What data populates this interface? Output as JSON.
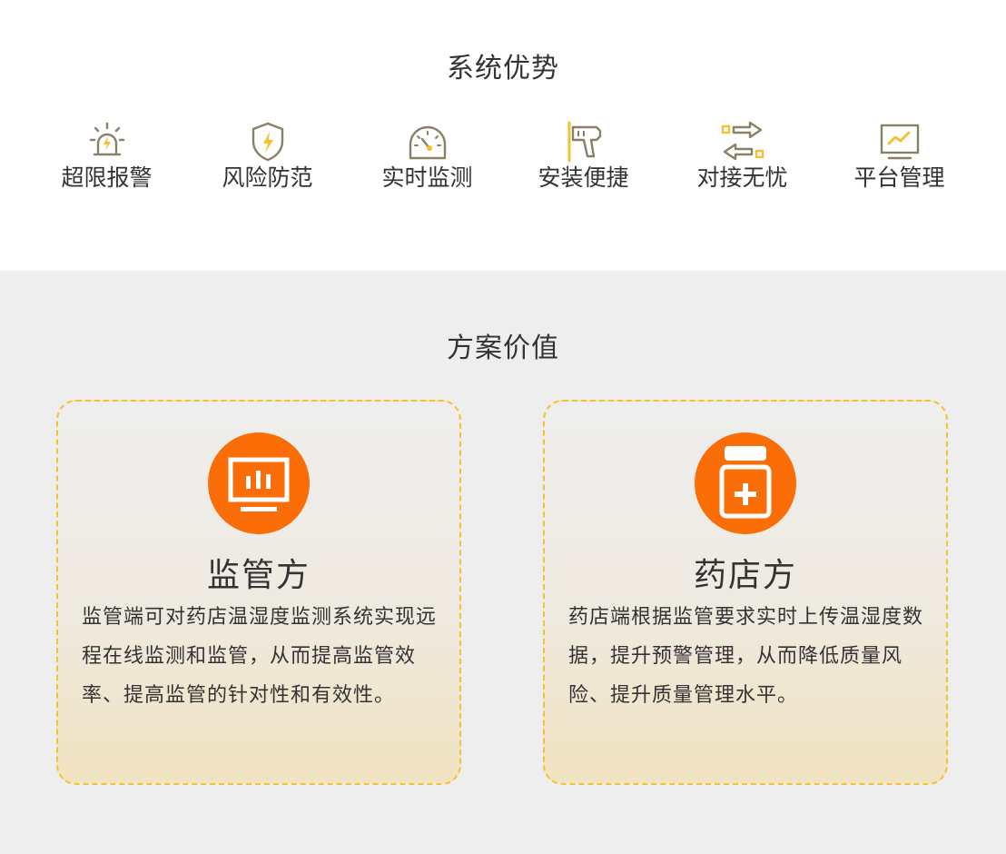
{
  "advantages": {
    "title": "系统优势",
    "items": [
      {
        "label": "超限报警",
        "icon": "alarm-light-icon"
      },
      {
        "label": "风险防范",
        "icon": "shield-lightning-icon"
      },
      {
        "label": "实时监测",
        "icon": "gauge-icon"
      },
      {
        "label": "安装便捷",
        "icon": "drill-icon"
      },
      {
        "label": "对接无忧",
        "icon": "exchange-arrows-icon"
      },
      {
        "label": "平台管理",
        "icon": "monitor-chart-icon"
      }
    ]
  },
  "value": {
    "title": "方案价值",
    "cards": [
      {
        "title": "监管方",
        "icon": "monitor-bar-chart-icon",
        "desc": "监管端可对药店温湿度监测系统实现远程在线监测和监管，从而提高监管效率、提高监管的针对性和有效性。"
      },
      {
        "title": "药店方",
        "icon": "medicine-bottle-icon",
        "desc": "药店端根据监管要求实时上传温湿度数据，提升预警管理，从而降低质量风险、提升质量管理水平。"
      }
    ]
  },
  "colors": {
    "accent_orange": "#fa6d07",
    "icon_gold": "#f5c131",
    "icon_stroke": "#8a8065",
    "card_border": "#f5c131",
    "section_bg": "#eeeeee"
  }
}
